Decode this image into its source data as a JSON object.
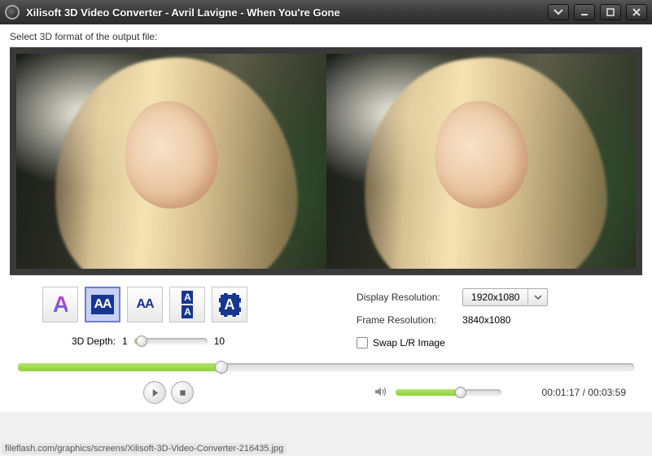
{
  "title": "Xilisoft 3D Video Converter - Avril Lavigne - When You're Gone",
  "instruction": "Select 3D format of the output file:",
  "formats": {
    "anaglyph": "A",
    "sbs_wide": "AA",
    "sbs_narrow": "AA",
    "stacked_top": "A",
    "stacked_bottom": "A",
    "dashed": "A"
  },
  "depth": {
    "label": "3D Depth:",
    "min": "1",
    "max": "10",
    "percent": 10
  },
  "display_resolution": {
    "label": "Display Resolution:",
    "value": "1920x1080"
  },
  "frame_resolution": {
    "label": "Frame Resolution:",
    "value": "3840x1080"
  },
  "swap": {
    "label": "Swap L/R Image"
  },
  "seek_percent": 33,
  "volume_percent": 62,
  "time": {
    "current": "00:01:17",
    "total": "00:03:59",
    "sep": " / "
  },
  "footer_path": "fileflash.com/graphics/screens/Xilisoft-3D-Video-Converter-216435.jpg"
}
